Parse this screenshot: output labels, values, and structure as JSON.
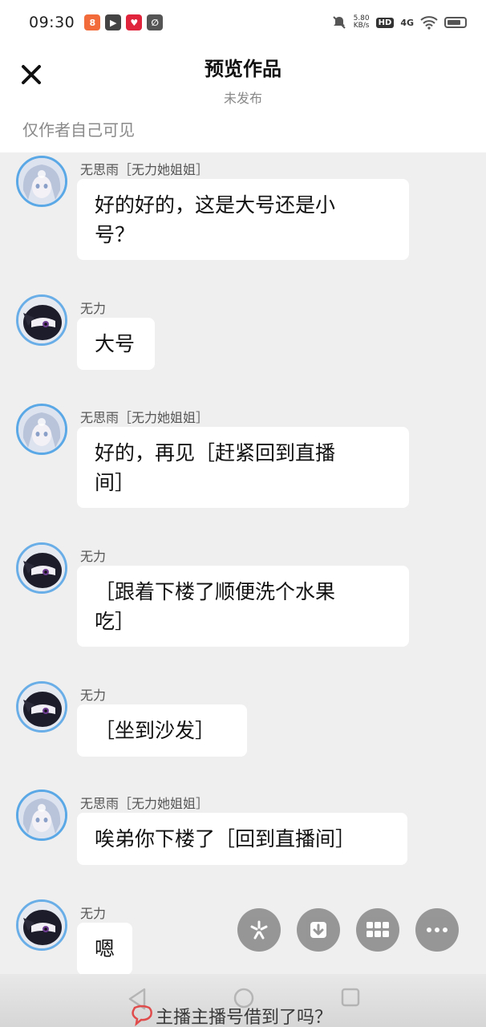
{
  "status_bar": {
    "time": "09:30",
    "net_speed_value": "5.80",
    "net_speed_unit": "KB/s",
    "hd": "HD",
    "network": "4G"
  },
  "header": {
    "title": "预览作品",
    "subtitle": "未发布",
    "visibility_note": "仅作者自己可见"
  },
  "messages": [
    {
      "sender": "无思雨［无力她姐姐］",
      "text_lines": [
        "好的好的，这是大号还是小",
        "号？"
      ]
    },
    {
      "sender": "无力",
      "text_lines": [
        "大号"
      ]
    },
    {
      "sender": "无思雨［无力她姐姐］",
      "text_lines": [
        "好的，再见［赶紧回到直播",
        "间］"
      ]
    },
    {
      "sender": "无力",
      "text_lines": [
        "［跟着下楼了顺便洗个水果",
        "吃］"
      ]
    },
    {
      "sender": "无力",
      "text_lines": [
        "［坐到沙发］"
      ]
    },
    {
      "sender": "无思雨［无力她姐姐］",
      "text_lines": [
        "唉弟你下楼了［回到直播间］"
      ]
    },
    {
      "sender": "无力",
      "text_lines": [
        "嗯"
      ]
    }
  ],
  "floating_actions": [
    "sparkle-icon",
    "download-icon",
    "grid-icon",
    "more-icon"
  ],
  "danmaku": "主播主播号借到了吗？",
  "colors": {
    "background": "#efefef",
    "bubble": "#ffffff",
    "avatar_ring": "#5aa8e6",
    "fab": "#8f8f8f"
  }
}
